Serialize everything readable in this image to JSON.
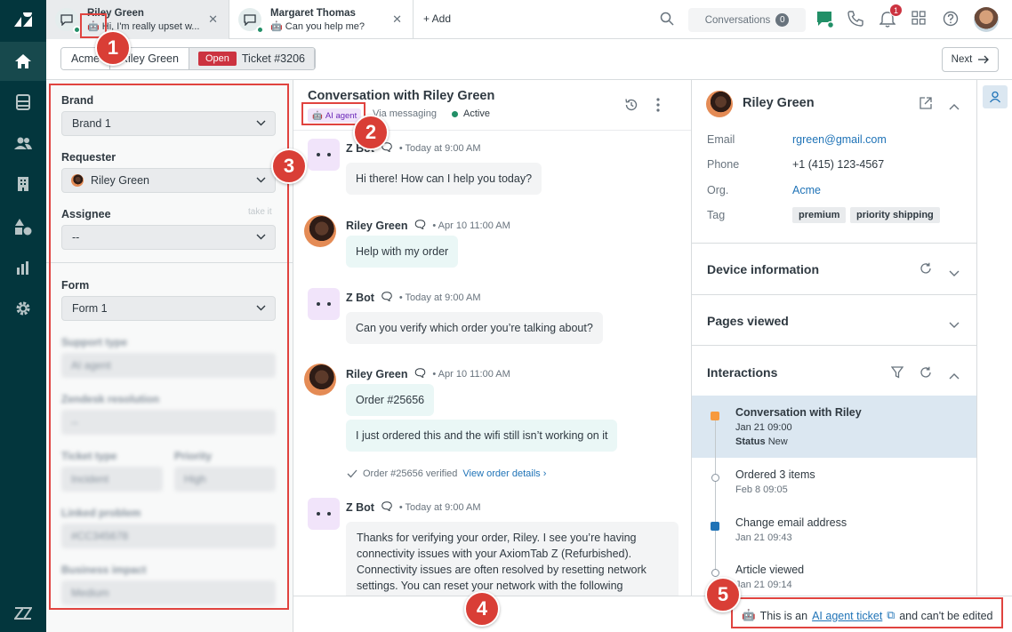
{
  "tabs": [
    {
      "title": "Riley Green",
      "preview": "Hi, I'm really upset w..."
    },
    {
      "title": "Margaret Thomas",
      "preview": "Can you help me?"
    }
  ],
  "topbar": {
    "add_label": "+ Add",
    "conversations_label": "Conversations",
    "conversations_count": "0",
    "notifications_count": "1"
  },
  "breadcrumb": {
    "org": "Acme",
    "user": "Riley Green",
    "status": "Open",
    "ticket": "Ticket #3206"
  },
  "next_label": "Next",
  "left_panel": {
    "brand_label": "Brand",
    "brand_value": "Brand 1",
    "requester_label": "Requester",
    "requester_value": "Riley Green",
    "assignee_label": "Assignee",
    "assignee_value": "--",
    "take_it": "take it",
    "form_label": "Form",
    "form_value": "Form 1",
    "support_type_label": "Support type",
    "support_type_value": "AI agent",
    "resolution_label": "Zendesk resolution",
    "resolution_value": "--",
    "ticket_type_label": "Ticket type",
    "ticket_type_value": "Incident",
    "priority_label": "Priority",
    "priority_value": "High",
    "linked_label": "Linked problem",
    "linked_value": "#CC345678",
    "impact_label": "Business impact",
    "impact_value": "Medium"
  },
  "conversation": {
    "title": "Conversation with Riley Green",
    "badge": "AI agent",
    "via": "Via messaging",
    "status": "Active",
    "messages": [
      {
        "name": "Z Bot",
        "time": "Today at 9:00 AM",
        "texts": [
          "Hi there! How can I help you today?"
        ]
      },
      {
        "name": "Riley Green",
        "time": "Apr 10 11:00 AM",
        "texts": [
          "Help with my order"
        ]
      },
      {
        "name": "Z Bot",
        "time": "Today at 9:00 AM",
        "texts": [
          "Can you verify which order you’re talking about?"
        ]
      },
      {
        "name": "Riley Green",
        "time": "Apr 10 11:00 AM",
        "texts": [
          "Order #25656",
          "I just ordered this and the wifi still isn’t working on it"
        ]
      },
      {
        "name": "Z Bot",
        "time": "Today at 9:00 AM",
        "texts": [
          "Thanks for verifying your order, Riley. I see you’re having connectivity issues with your AxiomTab Z (Refurbished). Connectivity issues are often resolved by resetting network settings. You can reset your network with the following"
        ]
      }
    ],
    "verified_text": "Order #25656 verified",
    "verified_link": "View order details"
  },
  "customer": {
    "name": "Riley Green",
    "email_label": "Email",
    "email": "rgreen@gmail.com",
    "phone_label": "Phone",
    "phone": "+1 (415) 123-4567",
    "org_label": "Org.",
    "org": "Acme",
    "tag_label": "Tag",
    "tags": [
      "premium",
      "priority shipping"
    ],
    "sections": [
      "Device information",
      "Pages viewed",
      "Interactions"
    ],
    "interactions": [
      {
        "title": "Conversation with Riley",
        "date": "Jan 21 09:00",
        "status_label": "Status",
        "status": "New"
      },
      {
        "title": "Ordered 3 items",
        "date": "Feb 8 09:05"
      },
      {
        "title": "Change email address",
        "date": "Jan 21 09:43"
      },
      {
        "title": "Article viewed",
        "date": "Jan 21 09:14"
      }
    ]
  },
  "footer": {
    "prefix": "This is an",
    "link": "AI agent ticket",
    "suffix": "and can't be edited"
  },
  "callouts": [
    "1",
    "2",
    "3",
    "4",
    "5"
  ],
  "colors": {
    "rail": "#03363d",
    "highlight": "#e0433f",
    "open_badge": "#cc3340",
    "link": "#1f73b7",
    "ai_badge_bg": "#f1e4fa"
  }
}
